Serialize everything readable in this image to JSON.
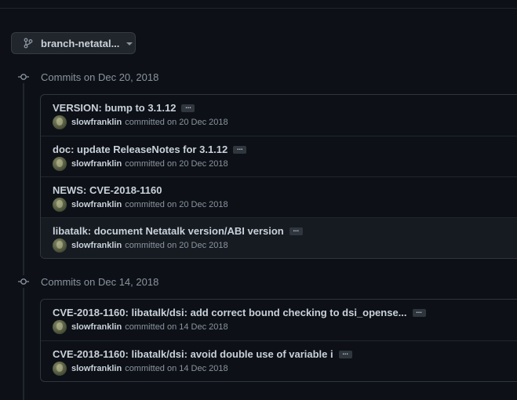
{
  "branch": {
    "label": "branch-netatal..."
  },
  "groups": [
    {
      "title": "Commits on Dec 20, 2018",
      "commits": [
        {
          "message": "VERSION: bump to 3.1.12",
          "author": "slowfranklin",
          "committed": "committed on 20 Dec 2018",
          "ellipsis": "..."
        },
        {
          "message": "doc: update ReleaseNotes for 3.1.12",
          "author": "slowfranklin",
          "committed": "committed on 20 Dec 2018",
          "ellipsis": "..."
        },
        {
          "message": "NEWS: CVE-2018-1160",
          "author": "slowfranklin",
          "committed": "committed on 20 Dec 2018"
        },
        {
          "message": "libatalk: document Netatalk version/ABI version",
          "author": "slowfranklin",
          "committed": "committed on 20 Dec 2018",
          "ellipsis": "..."
        }
      ]
    },
    {
      "title": "Commits on Dec 14, 2018",
      "commits": [
        {
          "message": "CVE-2018-1160: libatalk/dsi: add correct bound checking to dsi_opense...",
          "author": "slowfranklin",
          "committed": "committed on 14 Dec 2018",
          "ellipsis": "..."
        },
        {
          "message": "CVE-2018-1160: libatalk/dsi: avoid double use of variable i",
          "author": "slowfranklin",
          "committed": "committed on 14 Dec 2018",
          "ellipsis": "..."
        }
      ]
    }
  ]
}
